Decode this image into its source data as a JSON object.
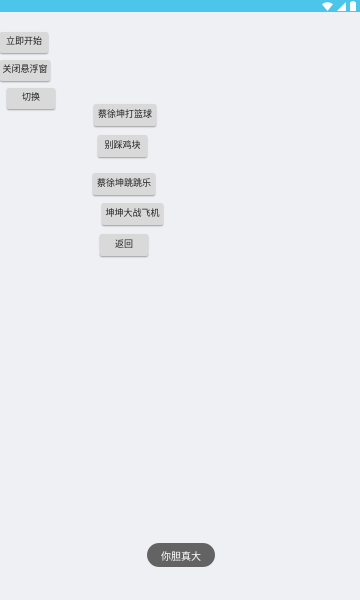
{
  "status_bar": {
    "color": "#4bc6ea",
    "icons": [
      "wifi-icon",
      "signal-icon",
      "battery-icon"
    ]
  },
  "float_controls": {
    "start": "立即开始",
    "close_float": "关闭悬浮窗",
    "switch": "切换"
  },
  "menu": {
    "basketball": "蔡徐坤打篮球",
    "step_blocks": "别踩鸡块",
    "jump": "蔡徐坤跳跳乐",
    "plane_war": "坤坤大战飞机",
    "back": "返回"
  },
  "toast": {
    "message": "你胆真大"
  }
}
